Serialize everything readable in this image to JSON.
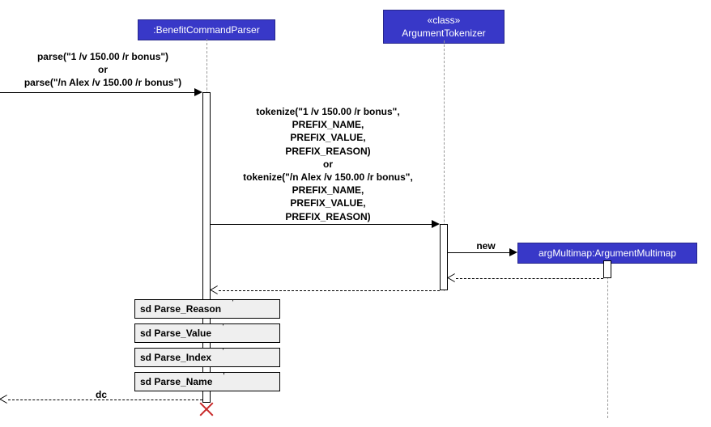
{
  "participants": {
    "p1": {
      "stereotype": "",
      "name": ":BenefitCommandParser"
    },
    "p2": {
      "stereotype": "«class»",
      "name": "ArgumentTokenizer"
    },
    "p3": {
      "stereotype": "",
      "name": "argMultimap:ArgumentMultimap"
    }
  },
  "messages": {
    "parse_call": "parse(\"1 /v 150.00 /r bonus\")\nor\nparse(\"/n Alex /v 150.00 /r bonus\")",
    "tokenize_call": "tokenize(\"1 /v 150.00 /r bonus\",\nPREFIX_NAME,\nPREFIX_VALUE,\nPREFIX_REASON)\nor\ntokenize(\"/n Alex /v 150.00 /r bonus\",\nPREFIX_NAME,\nPREFIX_VALUE,\nPREFIX_REASON)",
    "new": "new",
    "return_dc": "dc"
  },
  "refs": {
    "r1": "sd Parse_Reason",
    "r2": "sd Parse_Value",
    "r3": "sd Parse_Index",
    "r4": "sd Parse_Name"
  }
}
